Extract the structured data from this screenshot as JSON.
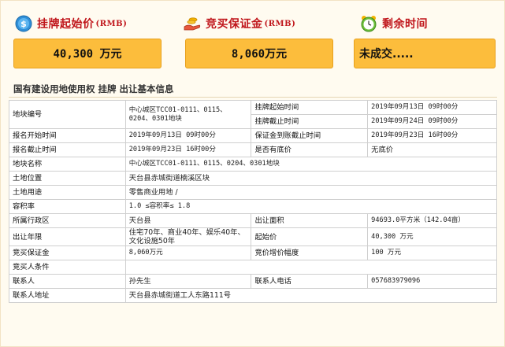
{
  "header": {
    "start_price_label": "挂牌起始价",
    "start_price_unit": "(RMB)",
    "deposit_label": "竞买保证金",
    "deposit_unit": "(RMB)",
    "remaining_label": "剩余时间"
  },
  "values": {
    "start_price": "40,300 万元",
    "deposit": "8,060万元",
    "remaining": "未成交....."
  },
  "section": {
    "title": "国有建设用地使用权 挂牌 出让基本信息"
  },
  "table": {
    "r1": {
      "k1": "地块编号",
      "v1": "中心城区TCC01-0111、0115、0204、0301地块",
      "k2a": "挂牌起始时间",
      "v2a": "2019年09月13日 09时00分",
      "k2b": "挂牌截止时间",
      "v2b": "2019年09月24日 09时00分"
    },
    "r2": {
      "k1": "报名开始时间",
      "v1": "2019年09月13日 09时00分",
      "k2": "保证金到账截止时间",
      "v2": "2019年09月23日 16时00分"
    },
    "r3": {
      "k1": "报名截止时间",
      "v1": "2019年09月23日 16时00分",
      "k2": "是否有底价",
      "v2": "无底价"
    },
    "r4": {
      "k": "地块名称",
      "v": "中心城区TCC01-0111、0115、0204、0301地块"
    },
    "r5": {
      "k": "土地位置",
      "v": "天台县赤城街道楠溪区块"
    },
    "r6": {
      "k": "土地用途",
      "v": "零售商业用地 /"
    },
    "r7": {
      "k": "容积率",
      "v": "1.0 ≤容积率≤ 1.8"
    },
    "r8": {
      "k1": "所属行政区",
      "v1": "天台县",
      "k2": "出让面积",
      "v2": "94693.0平方米（142.04亩）"
    },
    "r9": {
      "k1": "出让年限",
      "v1": "住宅70年、商业40年、娱乐40年、文化设施50年",
      "k2": "起始价",
      "v2": "40,300 万元"
    },
    "r10": {
      "k1": "竞买保证金",
      "v1": "8,060万元",
      "k2": "竞价增价幅度",
      "v2": "100 万元"
    },
    "r11": {
      "k": "竞买人条件",
      "v": ""
    },
    "r12": {
      "k1": "联系人",
      "v1": "孙先生",
      "k2": "联系人电话",
      "v2": "057683979096"
    },
    "r13": {
      "k": "联系人地址",
      "v": "天台县赤城街道工人东路111号"
    }
  },
  "colors": {
    "accent_red": "#c0161b",
    "value_box": "#fcbd3c",
    "background": "#fffbf0"
  },
  "icons": [
    "dollar-coin-icon",
    "hand-coins-icon",
    "alarm-clock-icon"
  ]
}
